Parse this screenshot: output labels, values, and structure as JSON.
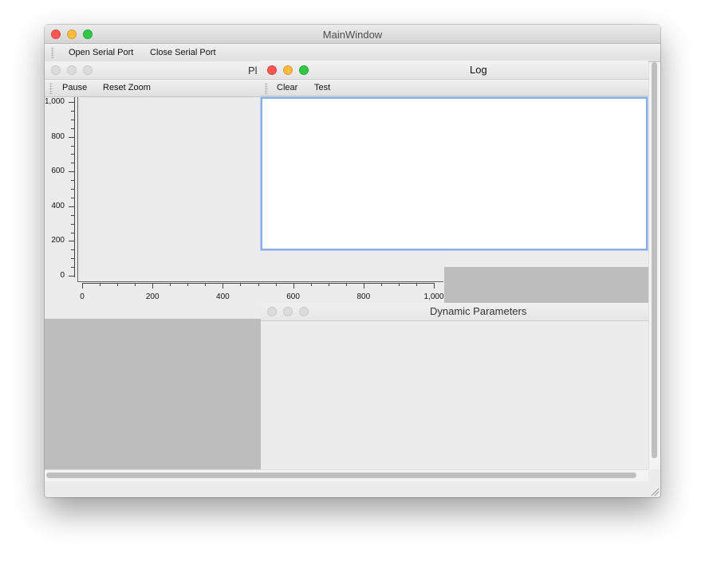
{
  "main_window": {
    "title": "MainWindow",
    "toolbar": {
      "open_label": "Open Serial Port",
      "close_label": "Close Serial Port"
    }
  },
  "plot_dock": {
    "title_visible": "Pl",
    "toolbar": {
      "pause_label": "Pause",
      "reset_zoom_label": "Reset Zoom"
    }
  },
  "log_dock": {
    "title": "Log",
    "toolbar": {
      "clear_label": "Clear",
      "test_label": "Test"
    },
    "text_value": ""
  },
  "params_dock": {
    "title": "Dynamic Parameters"
  },
  "chart_data": {
    "type": "line",
    "title": "",
    "xlabel": "",
    "ylabel": "",
    "xlim": [
      0,
      1000
    ],
    "ylim": [
      0,
      1000
    ],
    "x_ticks": [
      "0",
      "200",
      "400",
      "600",
      "800",
      "1,000"
    ],
    "y_ticks": [
      "0",
      "200",
      "400",
      "600",
      "800",
      "1,000"
    ],
    "grid": false,
    "series": []
  },
  "colors": {
    "close": "#fc5753",
    "minimize": "#fdbc40",
    "zoom": "#33c748",
    "focus_ring": "#88aee6",
    "empty_area": "#bdbdbd"
  }
}
